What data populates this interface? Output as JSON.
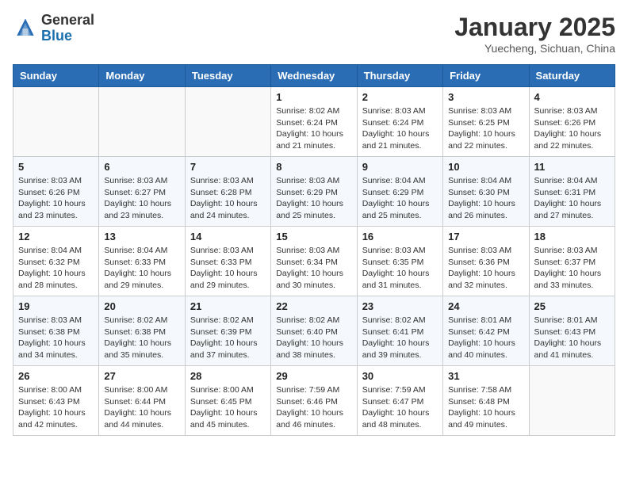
{
  "logo": {
    "general": "General",
    "blue": "Blue"
  },
  "header": {
    "month": "January 2025",
    "location": "Yuecheng, Sichuan, China"
  },
  "weekdays": [
    "Sunday",
    "Monday",
    "Tuesday",
    "Wednesday",
    "Thursday",
    "Friday",
    "Saturday"
  ],
  "weeks": [
    [
      {
        "day": "",
        "info": ""
      },
      {
        "day": "",
        "info": ""
      },
      {
        "day": "",
        "info": ""
      },
      {
        "day": "1",
        "info": "Sunrise: 8:02 AM\nSunset: 6:24 PM\nDaylight: 10 hours\nand 21 minutes."
      },
      {
        "day": "2",
        "info": "Sunrise: 8:03 AM\nSunset: 6:24 PM\nDaylight: 10 hours\nand 21 minutes."
      },
      {
        "day": "3",
        "info": "Sunrise: 8:03 AM\nSunset: 6:25 PM\nDaylight: 10 hours\nand 22 minutes."
      },
      {
        "day": "4",
        "info": "Sunrise: 8:03 AM\nSunset: 6:26 PM\nDaylight: 10 hours\nand 22 minutes."
      }
    ],
    [
      {
        "day": "5",
        "info": "Sunrise: 8:03 AM\nSunset: 6:26 PM\nDaylight: 10 hours\nand 23 minutes."
      },
      {
        "day": "6",
        "info": "Sunrise: 8:03 AM\nSunset: 6:27 PM\nDaylight: 10 hours\nand 23 minutes."
      },
      {
        "day": "7",
        "info": "Sunrise: 8:03 AM\nSunset: 6:28 PM\nDaylight: 10 hours\nand 24 minutes."
      },
      {
        "day": "8",
        "info": "Sunrise: 8:03 AM\nSunset: 6:29 PM\nDaylight: 10 hours\nand 25 minutes."
      },
      {
        "day": "9",
        "info": "Sunrise: 8:04 AM\nSunset: 6:29 PM\nDaylight: 10 hours\nand 25 minutes."
      },
      {
        "day": "10",
        "info": "Sunrise: 8:04 AM\nSunset: 6:30 PM\nDaylight: 10 hours\nand 26 minutes."
      },
      {
        "day": "11",
        "info": "Sunrise: 8:04 AM\nSunset: 6:31 PM\nDaylight: 10 hours\nand 27 minutes."
      }
    ],
    [
      {
        "day": "12",
        "info": "Sunrise: 8:04 AM\nSunset: 6:32 PM\nDaylight: 10 hours\nand 28 minutes."
      },
      {
        "day": "13",
        "info": "Sunrise: 8:04 AM\nSunset: 6:33 PM\nDaylight: 10 hours\nand 29 minutes."
      },
      {
        "day": "14",
        "info": "Sunrise: 8:03 AM\nSunset: 6:33 PM\nDaylight: 10 hours\nand 29 minutes."
      },
      {
        "day": "15",
        "info": "Sunrise: 8:03 AM\nSunset: 6:34 PM\nDaylight: 10 hours\nand 30 minutes."
      },
      {
        "day": "16",
        "info": "Sunrise: 8:03 AM\nSunset: 6:35 PM\nDaylight: 10 hours\nand 31 minutes."
      },
      {
        "day": "17",
        "info": "Sunrise: 8:03 AM\nSunset: 6:36 PM\nDaylight: 10 hours\nand 32 minutes."
      },
      {
        "day": "18",
        "info": "Sunrise: 8:03 AM\nSunset: 6:37 PM\nDaylight: 10 hours\nand 33 minutes."
      }
    ],
    [
      {
        "day": "19",
        "info": "Sunrise: 8:03 AM\nSunset: 6:38 PM\nDaylight: 10 hours\nand 34 minutes."
      },
      {
        "day": "20",
        "info": "Sunrise: 8:02 AM\nSunset: 6:38 PM\nDaylight: 10 hours\nand 35 minutes."
      },
      {
        "day": "21",
        "info": "Sunrise: 8:02 AM\nSunset: 6:39 PM\nDaylight: 10 hours\nand 37 minutes."
      },
      {
        "day": "22",
        "info": "Sunrise: 8:02 AM\nSunset: 6:40 PM\nDaylight: 10 hours\nand 38 minutes."
      },
      {
        "day": "23",
        "info": "Sunrise: 8:02 AM\nSunset: 6:41 PM\nDaylight: 10 hours\nand 39 minutes."
      },
      {
        "day": "24",
        "info": "Sunrise: 8:01 AM\nSunset: 6:42 PM\nDaylight: 10 hours\nand 40 minutes."
      },
      {
        "day": "25",
        "info": "Sunrise: 8:01 AM\nSunset: 6:43 PM\nDaylight: 10 hours\nand 41 minutes."
      }
    ],
    [
      {
        "day": "26",
        "info": "Sunrise: 8:00 AM\nSunset: 6:43 PM\nDaylight: 10 hours\nand 42 minutes."
      },
      {
        "day": "27",
        "info": "Sunrise: 8:00 AM\nSunset: 6:44 PM\nDaylight: 10 hours\nand 44 minutes."
      },
      {
        "day": "28",
        "info": "Sunrise: 8:00 AM\nSunset: 6:45 PM\nDaylight: 10 hours\nand 45 minutes."
      },
      {
        "day": "29",
        "info": "Sunrise: 7:59 AM\nSunset: 6:46 PM\nDaylight: 10 hours\nand 46 minutes."
      },
      {
        "day": "30",
        "info": "Sunrise: 7:59 AM\nSunset: 6:47 PM\nDaylight: 10 hours\nand 48 minutes."
      },
      {
        "day": "31",
        "info": "Sunrise: 7:58 AM\nSunset: 6:48 PM\nDaylight: 10 hours\nand 49 minutes."
      },
      {
        "day": "",
        "info": ""
      }
    ]
  ]
}
